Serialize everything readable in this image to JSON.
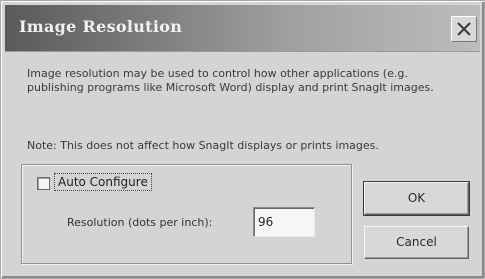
{
  "dialog": {
    "title": "Image Resolution",
    "description": "Image resolution may be used to control how other applications (e.g. publishing programs like Microsoft Word) display and print SnagIt images.",
    "note": "Note: This does not affect how SnagIt displays or prints images.",
    "auto_configure": {
      "label": "Auto Configure",
      "checked": false
    },
    "resolution": {
      "label": "Resolution (dots per inch):",
      "value": "96"
    },
    "buttons": {
      "ok": "OK",
      "cancel": "Cancel"
    },
    "icons": {
      "close": "close-icon"
    }
  }
}
